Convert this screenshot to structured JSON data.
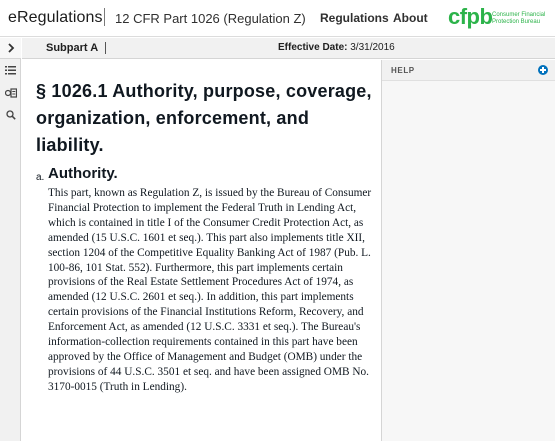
{
  "header": {
    "app_title": "eRegulations",
    "regulation_title": "12 CFR Part 1026 (Regulation Z)",
    "nav": {
      "regulations": "Regulations",
      "about": "About"
    },
    "logo": {
      "mark": "cfpb",
      "text": "Consumer Financial Protection Bureau"
    }
  },
  "rail": {
    "icons": [
      "chevron-right-icon",
      "list-icon",
      "history-icon",
      "search-icon"
    ]
  },
  "subheader": {
    "subpart": "Subpart A",
    "effective_label": "Effective Date:",
    "effective_date": "3/31/2016"
  },
  "content": {
    "section_title": "§ 1026.1 Authority, purpose, coverage, organization, enforcement, and liability.",
    "paragraph_marker": "a.",
    "paragraph_heading": "Authority.",
    "paragraph_body": "This part, known as Regulation Z, is issued by the Bureau of Consumer Financial Protection to implement the Federal Truth in Lending Act, which is contained in title I of the Consumer Credit Protection Act, as amended (15 U.S.C. 1601 et seq.). This part also implements title XII, section 1204 of the Competitive Equality Banking Act of 1987 (Pub. L. 100-86, 101 Stat. 552). Furthermore, this part implements certain provisions of the Real Estate Settlement Procedures Act of 1974, as amended (12 U.S.C. 2601 et seq.). In addition, this part implements certain provisions of the Financial Institutions Reform, Recovery, and Enforcement Act, as amended (12 U.S.C. 3331 et seq.). The Bureau's information-collection requirements contained in this part have been approved by the Office of Management and Budget (OMB) under the provisions of 44 U.S.C. 3501 et seq. and have been assigned OMB No. 3170-0015 (Truth in Lending)."
  },
  "panel": {
    "help_label": "HELP"
  },
  "colors": {
    "brand_green": "#2cb34a",
    "accent_blue": "#0071bc"
  }
}
